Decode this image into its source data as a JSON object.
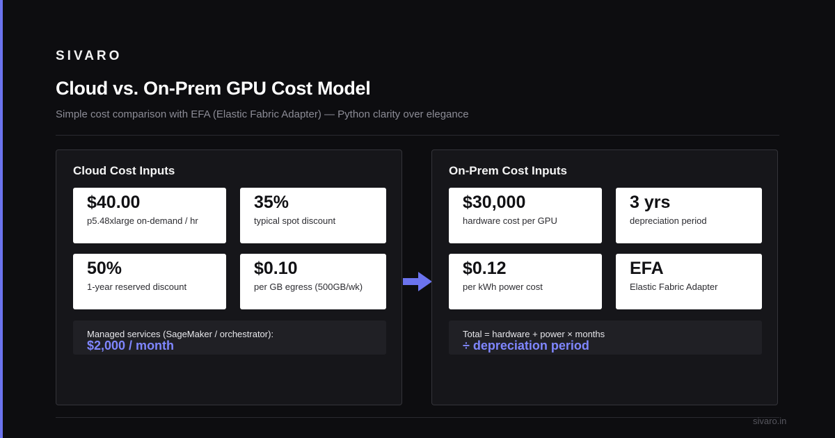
{
  "brand": "SIVARO",
  "title": "Cloud vs. On-Prem GPU Cost Model",
  "subtitle": "Simple cost comparison with EFA (Elastic Fabric Adapter) — Python clarity over elegance",
  "colors": {
    "accent": "#6b73ee",
    "highlight": "#7f86ff",
    "background": "#0d0d10",
    "panel": "#16161a",
    "card": "#ffffff"
  },
  "cloud": {
    "title": "Cloud Cost Inputs",
    "cards": [
      {
        "value": "$40.00",
        "label": "p5.48xlarge on-demand / hr"
      },
      {
        "value": "35%",
        "label": "typical spot discount"
      },
      {
        "value": "50%",
        "label": "1-year reserved discount"
      },
      {
        "value": "$0.10",
        "label": "per GB egress (500GB/wk)"
      }
    ],
    "note": {
      "text": "Managed services (SageMaker / orchestrator):",
      "value": "$2,000 / month"
    }
  },
  "onprem": {
    "title": "On-Prem Cost Inputs",
    "cards": [
      {
        "value": "$30,000",
        "label": "hardware cost per GPU"
      },
      {
        "value": "3 yrs",
        "label": "depreciation period"
      },
      {
        "value": "$0.12",
        "label": "per kWh power cost"
      },
      {
        "value": "EFA",
        "label": "Elastic Fabric Adapter"
      }
    ],
    "note": {
      "text": "Total = hardware + power × months",
      "value": "÷ depreciation period"
    }
  },
  "arrow_icon": "arrow-right-icon",
  "footer": "sivaro.in"
}
